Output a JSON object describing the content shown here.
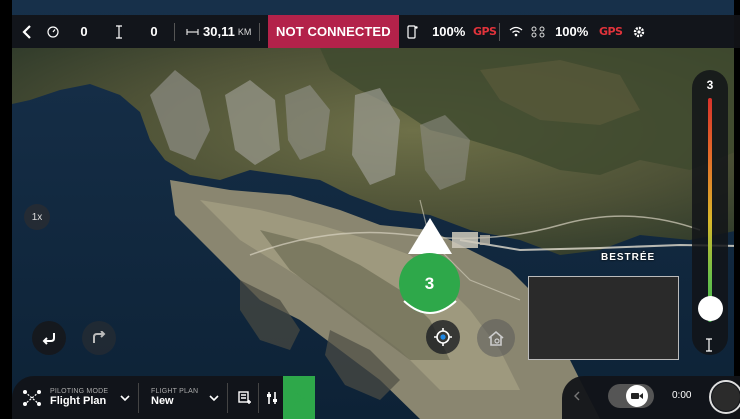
{
  "topbar": {
    "back_icon": "chevron-left-icon",
    "timer_icon": "stopwatch-icon",
    "flight_time": "0",
    "altitude_icon": "altitude-icon",
    "altitude": "0",
    "distance_icon": "distance-icon",
    "distance_value": "30,11",
    "distance_unit": "KM",
    "status": "NOT CONNECTED",
    "status_color": "#b3224a",
    "phone_battery": "100%",
    "phone_gps": "GPS",
    "drone_battery": "100%",
    "drone_gps": "GPS",
    "gps_color": "#e0333b",
    "settings_icon": "gear-icon"
  },
  "map": {
    "zoom_badge": "1x",
    "place_label": "BESTRÉE",
    "drone_satellites": "3",
    "drone_color": "#2ea84a"
  },
  "altitude_slider": {
    "max_value": "3",
    "level": 0.1,
    "icon": "altitude-icon"
  },
  "bottom_bar": {
    "piloting_mode_label": "PILOTING MODE",
    "piloting_mode_value": "Flight Plan",
    "flight_plan_label": "FLIGHT PLAN",
    "flight_plan_value": "New",
    "play_color": "#2ea84a"
  },
  "camera_bar": {
    "record_time": "0:00"
  }
}
